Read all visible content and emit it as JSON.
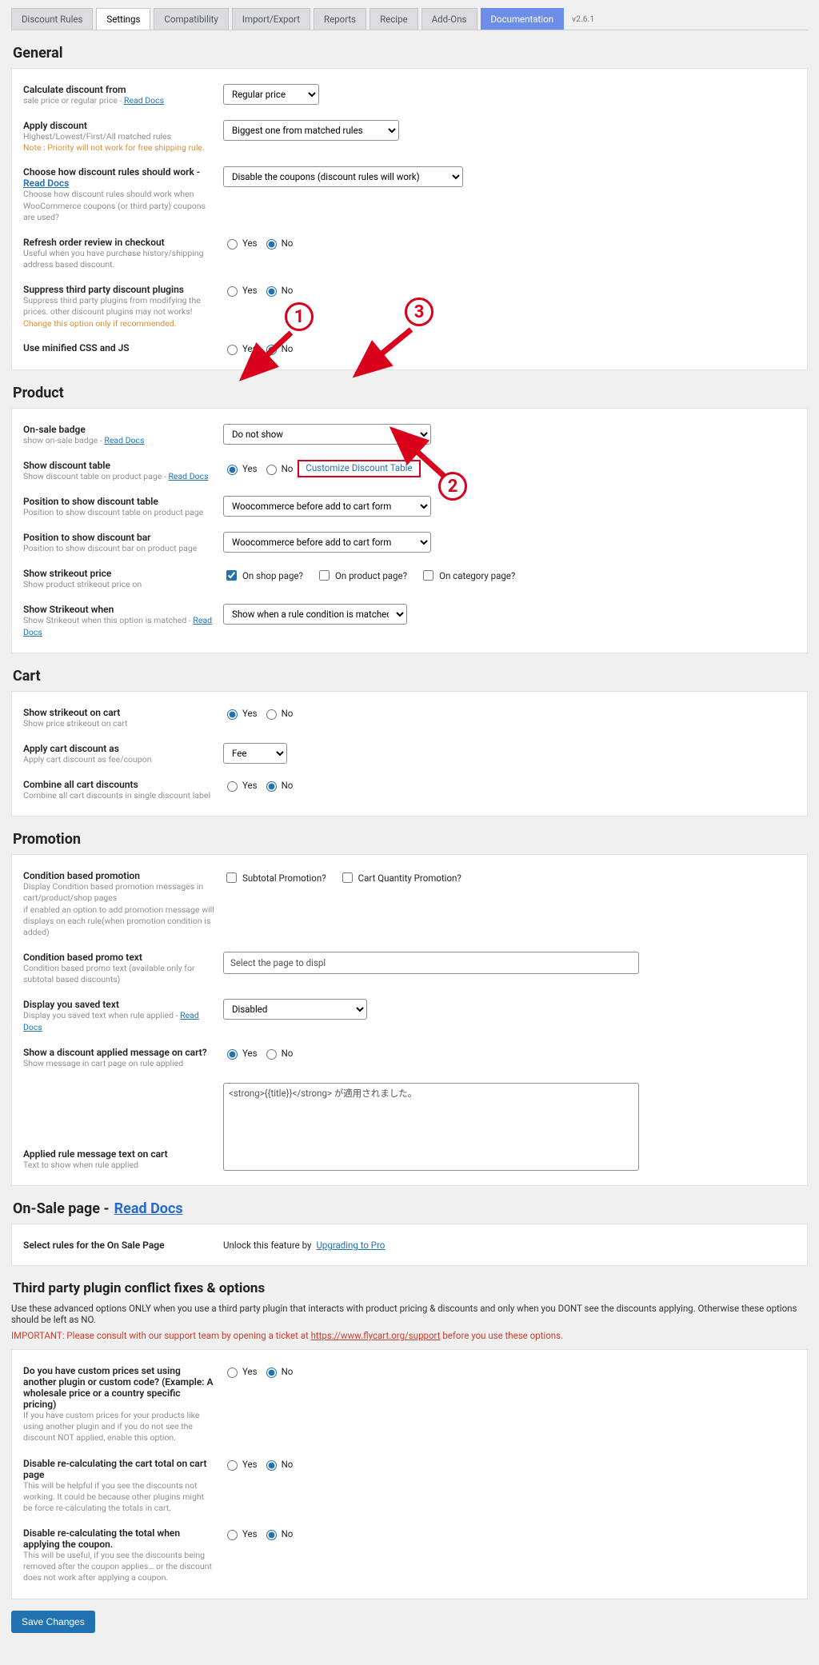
{
  "tabs": {
    "discount_rules": "Discount Rules",
    "settings": "Settings",
    "compatibility": "Compatibility",
    "import_export": "Import/Export",
    "reports": "Reports",
    "recipe": "Recipe",
    "addons": "Add-Ons",
    "documentation": "Documentation",
    "version": "v2.6.1"
  },
  "sections": {
    "general": "General",
    "product": "Product",
    "cart": "Cart",
    "promotion": "Promotion",
    "onsale_prefix": "On-Sale page - ",
    "onsale_link": "Read Docs",
    "third_party": "Third party plugin conflict fixes & options"
  },
  "yes": "Yes",
  "no": "No",
  "general": {
    "calc_from": {
      "label": "Calculate discount from",
      "desc": "sale price or regular price - ",
      "link": "Read Docs",
      "value": "Regular price"
    },
    "apply_disc": {
      "label": "Apply discount",
      "desc": "Highest/Lowest/First/All matched rules",
      "note": "Note : Priority will not work for free shipping rule.",
      "value": "Biggest one from matched rules"
    },
    "rules_work": {
      "label": "Choose how discount rules should work - ",
      "label_link": "Read Docs",
      "desc": "Choose how discount rules should work when WooCommerce coupons (or third party) coupons are used?",
      "value": "Disable the coupons (discount rules will work)"
    },
    "refresh": {
      "label": "Refresh order review in checkout",
      "desc": "Useful when you have purchase history/shipping address based discount.",
      "value": "no"
    },
    "suppress": {
      "label": "Suppress third party discount plugins",
      "desc": "Suppress third party plugins from modifying the prices. other discount plugins may not works!",
      "warn": "Change this option only if recommended.",
      "value": "no"
    },
    "minify": {
      "label": "Use minified CSS and JS",
      "value": "no"
    }
  },
  "product": {
    "onsale_badge": {
      "label": "On-sale badge",
      "desc": "show on-sale badge - ",
      "link": "Read Docs",
      "value": "Do not show"
    },
    "show_table": {
      "label": "Show discount table",
      "desc": "Show discount table on product page - ",
      "link": "Read Docs",
      "value": "yes",
      "customize": "Customize Discount Table"
    },
    "pos_table": {
      "label": "Position to show discount table",
      "desc": "Position to show discount table on product page",
      "value": "Woocommerce before add to cart form"
    },
    "pos_bar": {
      "label": "Position to show discount bar",
      "desc": "Position to show discount bar on product page",
      "value": "Woocommerce before add to cart form"
    },
    "strike_price": {
      "label": "Show strikeout price",
      "desc": "Show product strikeout price on",
      "chk1": "On shop page?",
      "chk2": "On product page?",
      "chk3": "On category page?"
    },
    "strike_when": {
      "label": "Show Strikeout when",
      "desc": "Show Strikeout when this option is matched - ",
      "link": "Read Docs",
      "value": "Show when a rule condition is matched"
    }
  },
  "cart": {
    "strike_cart": {
      "label": "Show strikeout on cart",
      "desc": "Show price strikeout on cart",
      "value": "yes"
    },
    "apply_as": {
      "label": "Apply cart discount as",
      "desc": "Apply cart discount as fee/coupon",
      "value": "Fee"
    },
    "combine": {
      "label": "Combine all cart discounts",
      "desc": "Combine all cart discounts in single discount label",
      "value": "no"
    }
  },
  "promotion": {
    "cond_promo": {
      "label": "Condition based promotion",
      "desc": "Display Condition based promotion messages in cart/product/shop pages\nif enabled an option to add promotion message will displays on each rule(when promotion condition is added)",
      "chk1": "Subtotal Promotion?",
      "chk2": "Cart Quantity Promotion?"
    },
    "cond_text": {
      "label": "Condition based promo text",
      "desc": "Condition based promo text (available only for subtotal based discounts)",
      "placeholder": "Select the page to displ"
    },
    "saved_text": {
      "label": "Display you saved text",
      "desc": "Display you saved text when rule applied - ",
      "link": "Read Docs",
      "value": "Disabled"
    },
    "disc_msg": {
      "label": "Show a discount applied message on cart?",
      "desc": "Show message in cart page on rule applied",
      "value": "yes"
    },
    "applied_msg": {
      "label": "Applied rule message text on cart",
      "desc": "Text to show when rule applied",
      "value": "<strong>{{title}}</strong> が適用されました。"
    }
  },
  "onsale": {
    "label": "Select rules for the On Sale Page",
    "unlock_pre": "Unlock this feature by ",
    "unlock_link": "Upgrading to Pro"
  },
  "third": {
    "info": "Use these advanced options ONLY when you use a third party plugin that interacts with product pricing & discounts and only when you DONT see the discounts applying. Otherwise these options should be left as NO.",
    "important_pre": "IMPORTANT: Please consult with our support team by opening a ticket at ",
    "important_link": "https://www.flycart.org/support",
    "important_post": " before you use these options.",
    "custom_prices": {
      "label": "Do you have custom prices set using another plugin or custom code? (Example: A wholesale price or a country specific pricing)",
      "desc": "If you have custom prices for your products like using another plugin and if you do not see the discount NOT applied, enable this option.",
      "value": "no"
    },
    "recalc_cart": {
      "label": "Disable re-calculating the cart total on cart page",
      "desc": "This will be helpful if you see the discounts not working. It could be because other plugins might be force re-calculating the totals in cart.",
      "value": "no"
    },
    "recalc_coupon": {
      "label": "Disable re-calculating the total when applying the coupon.",
      "desc": "This will be useful, if you see the discounts being removed after the coupon applies… or the discount does not work after applying a coupon.",
      "value": "no"
    }
  },
  "save": "Save Changes",
  "anno": {
    "one": "1",
    "two": "2",
    "three": "3"
  }
}
